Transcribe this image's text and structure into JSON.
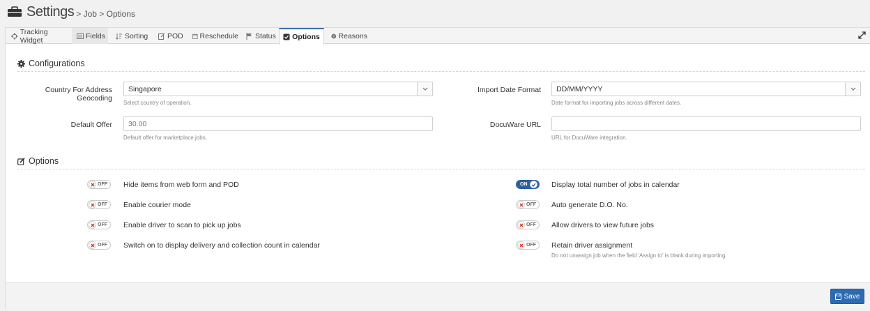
{
  "header": {
    "title": "Settings",
    "breadcrumb": "> Job > Options"
  },
  "tabs": [
    {
      "label": "Tracking Widget",
      "icon": "crosshair-icon"
    },
    {
      "label": "Fields",
      "icon": "list-icon"
    },
    {
      "label": "Sorting",
      "icon": "sort-icon"
    },
    {
      "label": "POD",
      "icon": "edit-icon"
    },
    {
      "label": "Reschedule",
      "icon": "calendar-icon"
    },
    {
      "label": "Status",
      "icon": "flag-icon"
    },
    {
      "label": "Options",
      "icon": "checkbox-icon"
    },
    {
      "label": "Reasons",
      "icon": "question-icon"
    }
  ],
  "configurations": {
    "heading": "Configurations",
    "country": {
      "label": "Country For Address Geocoding",
      "value": "Singapore",
      "help": "Select country of operation."
    },
    "import_date": {
      "label": "Import Date Format",
      "value": "DD/MM/YYYY",
      "help": "Date format for importing jobs across different dates."
    },
    "default_offer": {
      "label": "Default Offer",
      "placeholder": "30.00",
      "help": "Default offer for marketplace jobs."
    },
    "docuware": {
      "label": "DocuWare URL",
      "value": "",
      "help": "URL for DocuWare integration."
    }
  },
  "options": {
    "heading": "Options",
    "left": [
      {
        "label": "Hide items from web form and POD",
        "state": "OFF"
      },
      {
        "label": "Enable courier mode",
        "state": "OFF"
      },
      {
        "label": "Enable driver to scan to pick up jobs",
        "state": "OFF"
      },
      {
        "label": "Switch on to display delivery and collection count in calendar",
        "state": "OFF"
      }
    ],
    "right": [
      {
        "label": "Display total number of jobs in calendar",
        "state": "ON"
      },
      {
        "label": "Auto generate D.O. No.",
        "state": "OFF"
      },
      {
        "label": "Allow drivers to view future jobs",
        "state": "OFF"
      },
      {
        "label": "Retain driver assignment",
        "state": "OFF",
        "help": "Do not unassign job when the field 'Assign to' is blank during importing."
      }
    ]
  },
  "footer": {
    "save_label": "Save"
  },
  "colors": {
    "accent": "#2d6bb0",
    "toggle_on": "#2f5f9c",
    "off_x": "#c0392b"
  }
}
